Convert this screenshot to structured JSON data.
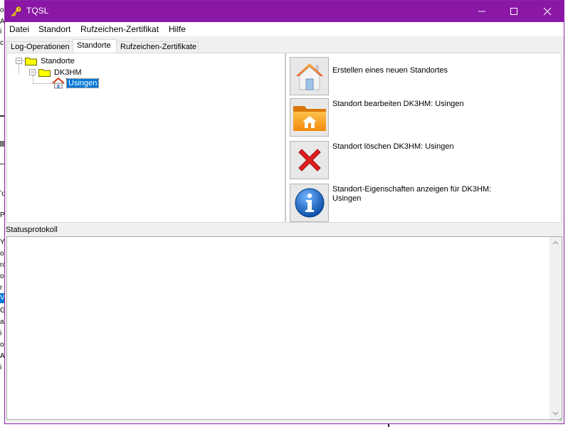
{
  "window": {
    "title": "TQSL",
    "accent_color": "#8a17a6",
    "controls": [
      "minimize-icon",
      "maximize-icon",
      "close-icon"
    ]
  },
  "menu": [
    "Datei",
    "Standort",
    "Rufzeichen-Zertifikat",
    "Hilfe"
  ],
  "tabs": [
    {
      "label": "Log-Operationen",
      "active": false
    },
    {
      "label": "Standorte",
      "active": true
    },
    {
      "label": "Rufzeichen-Zertifikate",
      "active": false
    }
  ],
  "tree": {
    "root": {
      "label": "Standorte",
      "icon": "folder-icon"
    },
    "callsign": {
      "label": "DK3HM",
      "icon": "folder-icon"
    },
    "location": {
      "label": "Usingen",
      "icon": "house-icon",
      "selected": true
    }
  },
  "actions": [
    {
      "label": "Erstellen eines neuen Standortes",
      "icon": "house-icon"
    },
    {
      "label": "Standort bearbeiten DK3HM: Usingen",
      "icon": "folder-house-icon"
    },
    {
      "label": "Standort löschen DK3HM: Usingen",
      "icon": "red-x-icon"
    },
    {
      "label": "Standort-Eigenschaften anzeigen für DK3HM: Usingen",
      "icon": "info-icon"
    }
  ],
  "status": {
    "label": "Statusprotokoll",
    "log": ""
  },
  "background_fragments": [
    "o",
    "A",
    "i",
    "c",
    "ʼo",
    "P",
    "Y",
    "o",
    "rc",
    "o",
    "r",
    "V",
    "G",
    "a",
    "i",
    "o",
    "o",
    "A",
    "i"
  ]
}
